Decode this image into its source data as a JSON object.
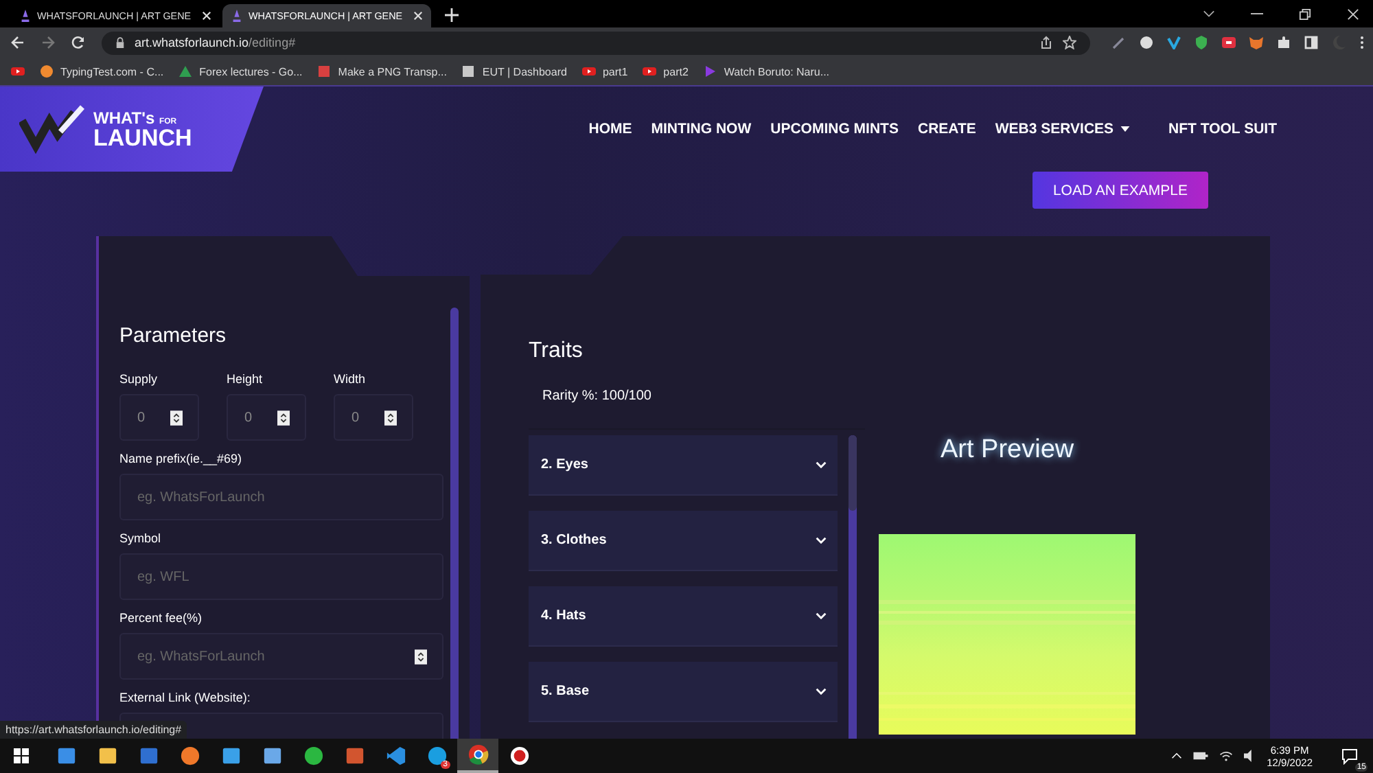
{
  "browser": {
    "tabs": [
      {
        "title": "WHATSFORLAUNCH | ART GENE",
        "selected": false
      },
      {
        "title": "WHATSFORLAUNCH | ART GENE",
        "selected": true
      }
    ],
    "address": {
      "host": "art.whatsforlaunch.io",
      "path": "/editing#"
    },
    "bookmarks": [
      {
        "kind": "youtube"
      },
      {
        "kind": "site",
        "label": "TypingTest.com - C..."
      },
      {
        "kind": "drive",
        "label": "Forex lectures - Go..."
      },
      {
        "kind": "tool",
        "label": "Make a PNG Transp..."
      },
      {
        "kind": "doc",
        "label": "EUT | Dashboard"
      },
      {
        "kind": "youtube",
        "label": "part1"
      },
      {
        "kind": "youtube",
        "label": "part2"
      },
      {
        "kind": "play",
        "label": "Watch Boruto: Naru..."
      }
    ]
  },
  "page": {
    "logo": {
      "top": "WHAT's",
      "small": "FOR",
      "bottom": "LAUNCH"
    },
    "nav": [
      {
        "label": "HOME",
        "dropdown": false
      },
      {
        "label": "MINTING NOW",
        "dropdown": false
      },
      {
        "label": "UPCOMING MINTS",
        "dropdown": false
      },
      {
        "label": "CREATE",
        "dropdown": false
      },
      {
        "label": "WEB3 SERVICES",
        "dropdown": true
      },
      {
        "label": "NFT TOOL SUIT",
        "dropdown": false
      }
    ],
    "load_button": "LOAD AN EXAMPLE",
    "parameters": {
      "title": "Parameters",
      "small_fields": [
        {
          "label": "Supply",
          "value": "0"
        },
        {
          "label": "Height",
          "value": "0"
        },
        {
          "label": "Width",
          "value": "0"
        }
      ],
      "fields": [
        {
          "label": "Name prefix(ie.__#69)",
          "placeholder": "eg. WhatsForLaunch",
          "spinner": false
        },
        {
          "label": "Symbol",
          "placeholder": "eg. WFL",
          "spinner": false
        },
        {
          "label": "Percent fee(%)",
          "placeholder": "eg. WhatsForLaunch",
          "spinner": true
        },
        {
          "label": "External Link (Website):",
          "spinner": false
        }
      ]
    },
    "traits": {
      "title": "Traits",
      "rarity": "Rarity %: 100/100",
      "items": [
        {
          "label": "2. Eyes",
          "expanded": false
        },
        {
          "label": "3. Clothes",
          "expanded": false
        },
        {
          "label": "4. Hats",
          "expanded": false
        },
        {
          "label": "5. Base",
          "expanded": false
        }
      ]
    },
    "preview": {
      "title": "Art Preview",
      "kind": "picture"
    },
    "status_url": "https://art.whatsforlaunch.io/editing#"
  },
  "taskbar": {
    "apps": [
      {
        "kind": "store",
        "selected": false
      },
      {
        "kind": "folder",
        "selected": false
      },
      {
        "kind": "calc",
        "selected": false
      },
      {
        "kind": "firefox",
        "selected": false
      },
      {
        "kind": "photos",
        "selected": false
      },
      {
        "kind": "window",
        "selected": false
      },
      {
        "kind": "whatsapp",
        "selected": false
      },
      {
        "kind": "slides",
        "selected": false
      },
      {
        "kind": "code",
        "selected": false
      },
      {
        "kind": "skype",
        "selected": false,
        "badge": "3"
      },
      {
        "kind": "chrome",
        "selected": true
      },
      {
        "kind": "record",
        "selected": false
      }
    ],
    "time": "6:39 PM",
    "date": "12/9/2022",
    "notifications": "15"
  }
}
